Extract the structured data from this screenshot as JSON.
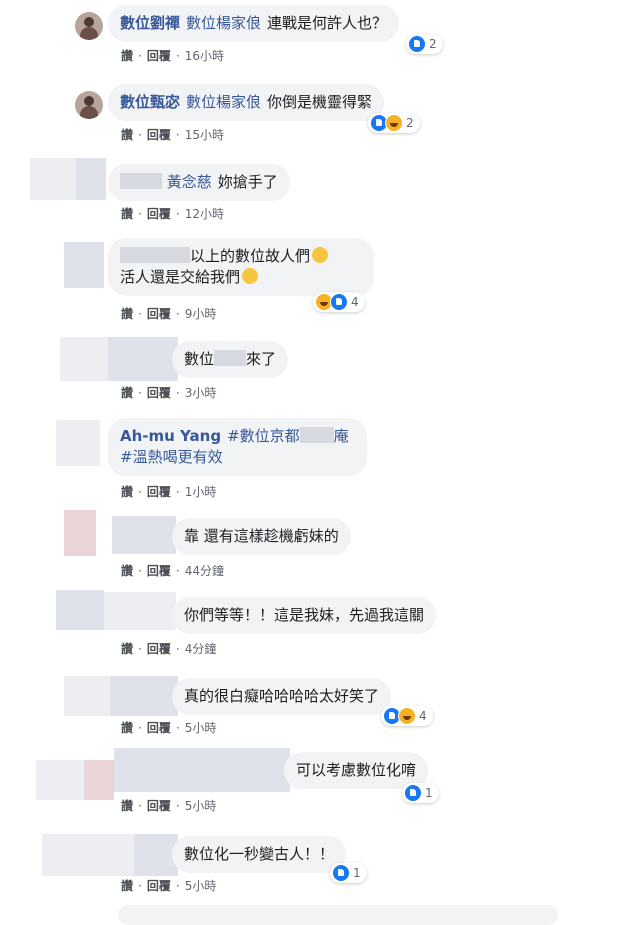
{
  "actions": {
    "like": "讚",
    "reply": "回覆",
    "dot": "·"
  },
  "comments": [
    {
      "author": "數位劉禪",
      "tag": "數位楊家俍",
      "text": "連戰是何許人也？",
      "time": "16小時",
      "reactions": 2
    },
    {
      "author": "數位甄宓",
      "tag": "數位楊家俍",
      "text": "你倒是機靈得緊",
      "time": "15小時",
      "reactions": 2
    },
    {
      "tag": "黃念慈",
      "text": "妳搶手了",
      "time": "12小時"
    },
    {
      "line1": "以上的數位故人們",
      "line2": "活人還是交給我們",
      "time": "9小時",
      "reactions": 4
    },
    {
      "text_a": "數位",
      "text_b": "來了",
      "time": "3小時"
    },
    {
      "author": "Ah-mu Yang",
      "tag": "#數位京都",
      "tag_end": "庵",
      "line2": "#溫熱喝更有效",
      "time": "1小時"
    },
    {
      "text": "靠 還有這樣趁機虧妹的",
      "time": "44分鐘"
    },
    {
      "text": "你們等等！！這是我妹，先過我這關",
      "time": "4分鐘"
    },
    {
      "text": "真的很白癡哈哈哈哈太好笑了",
      "time": "5小時",
      "reactions": 4
    },
    {
      "text": "可以考慮數位化唷",
      "time": "5小時",
      "reactions": 1
    },
    {
      "text": "數位化一秒變古人！！",
      "time": "5小時",
      "reactions": 1
    }
  ]
}
